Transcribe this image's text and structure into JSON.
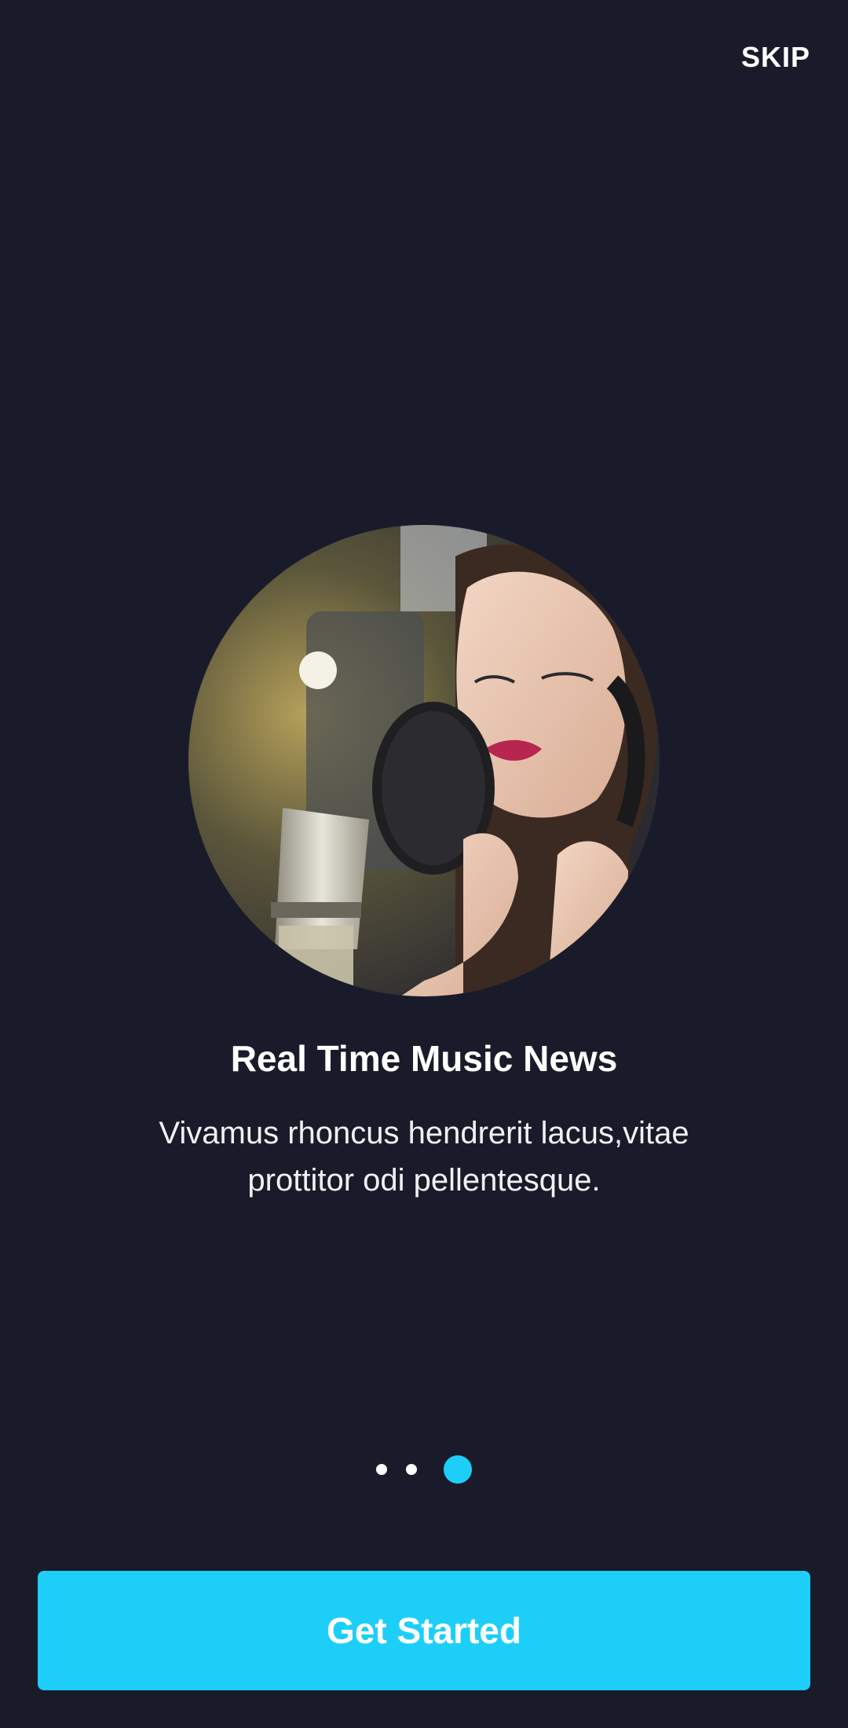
{
  "header": {
    "skip_label": "SKIP"
  },
  "hero": {
    "image_description_icon": "woman-singing-into-microphone-image"
  },
  "content": {
    "title": "Real Time Music News",
    "subtitle": "Vivamus rhoncus hendrerit lacus,vitae prottitor odi pellentesque."
  },
  "pager": {
    "total": 3,
    "active_index": 2
  },
  "footer": {
    "cta_label": "Get Started"
  },
  "colors": {
    "background": "#1a1b2a",
    "accent": "#1dcff8",
    "text": "#ffffff"
  }
}
